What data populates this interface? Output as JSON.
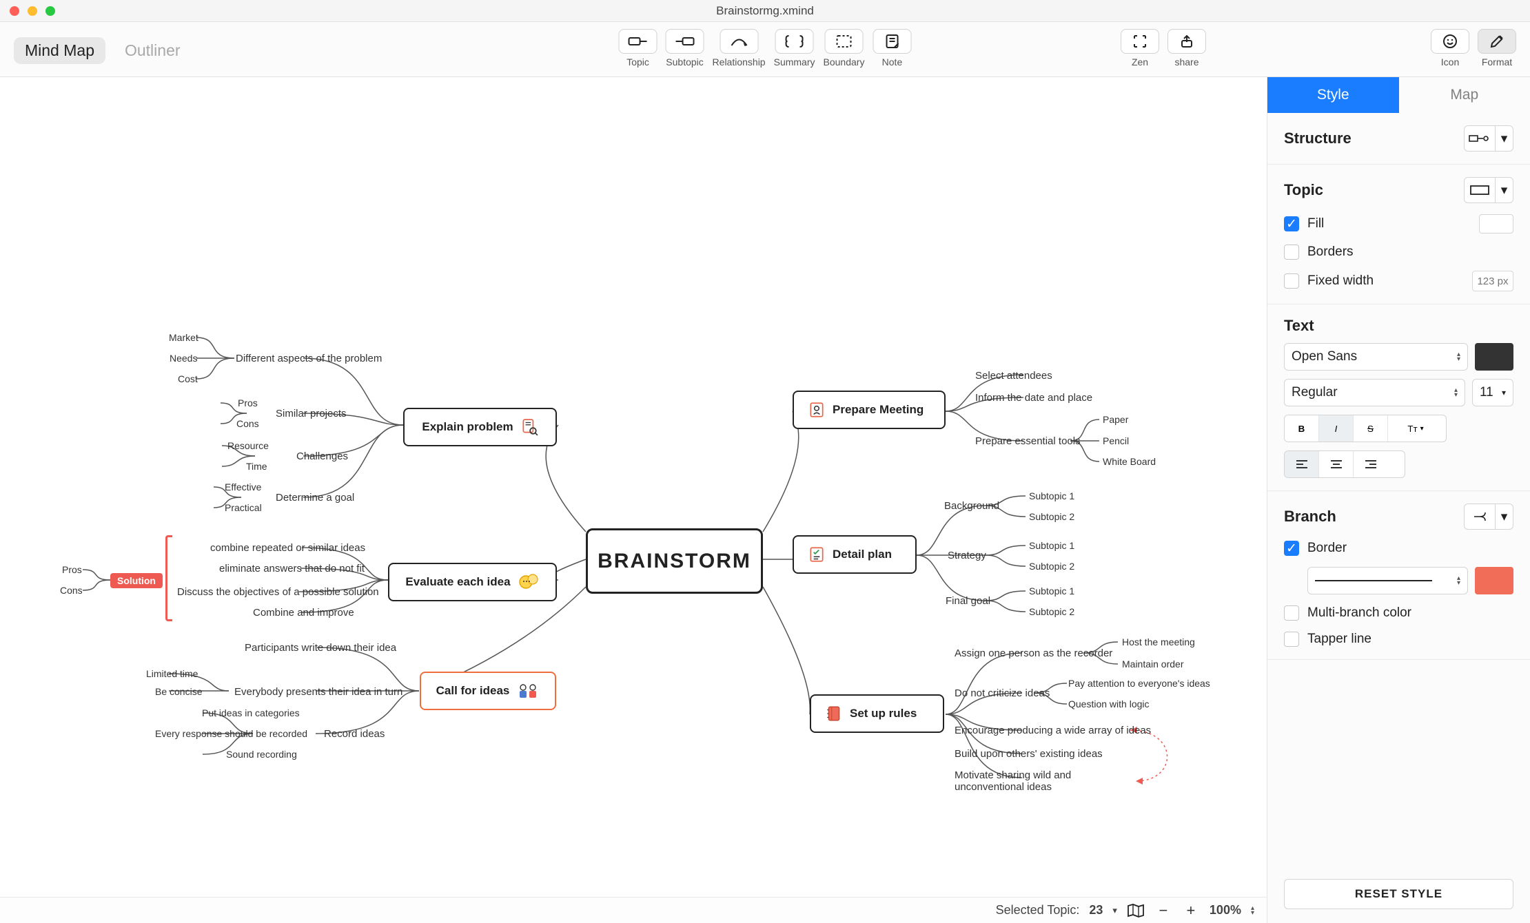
{
  "window": {
    "title": "Brainstormg.xmind"
  },
  "viewTabs": {
    "mindmap": "Mind Map",
    "outliner": "Outliner",
    "active": "mindmap"
  },
  "toolbar": {
    "items": [
      {
        "id": "topic",
        "label": "Topic"
      },
      {
        "id": "subtopic",
        "label": "Subtopic"
      },
      {
        "id": "relationship",
        "label": "Relationship"
      },
      {
        "id": "summary",
        "label": "Summary"
      },
      {
        "id": "boundary",
        "label": "Boundary"
      },
      {
        "id": "note",
        "label": "Note"
      }
    ],
    "zen": "Zen",
    "share": "share",
    "icon": "Icon",
    "format": "Format"
  },
  "canvas": {
    "central": "BRAINSTORM",
    "left": {
      "explain": {
        "label": "Explain problem",
        "branches": [
          {
            "label": "Different aspects of the problem",
            "leaves": [
              "Market",
              "Needs",
              "Cost"
            ]
          },
          {
            "label": "Similar projects",
            "leaves": [
              "Pros",
              "Cons"
            ]
          },
          {
            "label": "Challenges",
            "leaves": [
              "Resource",
              "Time"
            ]
          },
          {
            "label": "Determine a goal",
            "leaves": [
              "Effective",
              "Practical"
            ]
          }
        ]
      },
      "evaluate": {
        "label": "Evaluate each idea",
        "items": [
          "combine repeated or similar ideas",
          "eliminate answers that do not fit",
          "Discuss the objectives of a possible solution",
          "Combine and improve"
        ],
        "solution": {
          "label": "Solution",
          "leaves": [
            "Pros",
            "Cons"
          ]
        }
      },
      "call": {
        "label": "Call for ideas",
        "branches": [
          {
            "label": "Participants write down their idea"
          },
          {
            "label": "Everybody presents their idea in turn",
            "leaves": [
              "Limited time",
              "Be concise"
            ]
          },
          {
            "label": "Record ideas",
            "leaves": [
              "Put ideas in categories",
              "Every response should be recorded",
              "Sound recording"
            ]
          }
        ]
      }
    },
    "right": {
      "prepare": {
        "label": "Prepare Meeting",
        "items": [
          "Select attendees",
          "Inform the date and place"
        ],
        "tools": {
          "label": "Prepare essential tools",
          "leaves": [
            "Paper",
            "Pencil",
            "White Board"
          ]
        }
      },
      "detail": {
        "label": "Detail plan",
        "groups": [
          {
            "label": "Background",
            "leaves": [
              "Subtopic 1",
              "Subtopic 2"
            ]
          },
          {
            "label": "Strategy",
            "leaves": [
              "Subtopic 1",
              "Subtopic 2"
            ]
          },
          {
            "label": "Final goal",
            "leaves": [
              "Subtopic 1",
              "Subtopic 2"
            ]
          }
        ]
      },
      "rules": {
        "label": "Set up rules",
        "items": [
          {
            "label": "Assign one person as the recorder",
            "leaves": [
              "Host the meeting",
              "Maintain order"
            ]
          },
          {
            "label": "Do not criticize ideas",
            "leaves": [
              "Pay attention to everyone's ideas",
              "Question with logic"
            ]
          },
          {
            "label": "Encourage producing a wide array of ideas"
          },
          {
            "label": "Build upon others' existing ideas"
          },
          {
            "label": "Motivate sharing wild and unconventional ideas"
          }
        ]
      }
    }
  },
  "statusbar": {
    "selectedLabel": "Selected Topic:",
    "selectedCount": "23",
    "zoom": "100%"
  },
  "sidebar": {
    "tabs": {
      "style": "Style",
      "map": "Map",
      "active": "style"
    },
    "structure": {
      "title": "Structure"
    },
    "topic": {
      "title": "Topic",
      "fill": "Fill",
      "borders": "Borders",
      "fixed": "Fixed width",
      "fixedPlaceholder": "123 px",
      "fillChecked": true
    },
    "text": {
      "title": "Text",
      "font": "Open Sans",
      "weight": "Regular",
      "size": "11",
      "bold": "B",
      "italic": "I",
      "strike": "S",
      "transform": "Tᴛ"
    },
    "branch": {
      "title": "Branch",
      "border": "Border",
      "multi": "Multi-branch color",
      "tapper": "Tapper line",
      "borderChecked": true
    },
    "reset": "RESET STYLE"
  }
}
